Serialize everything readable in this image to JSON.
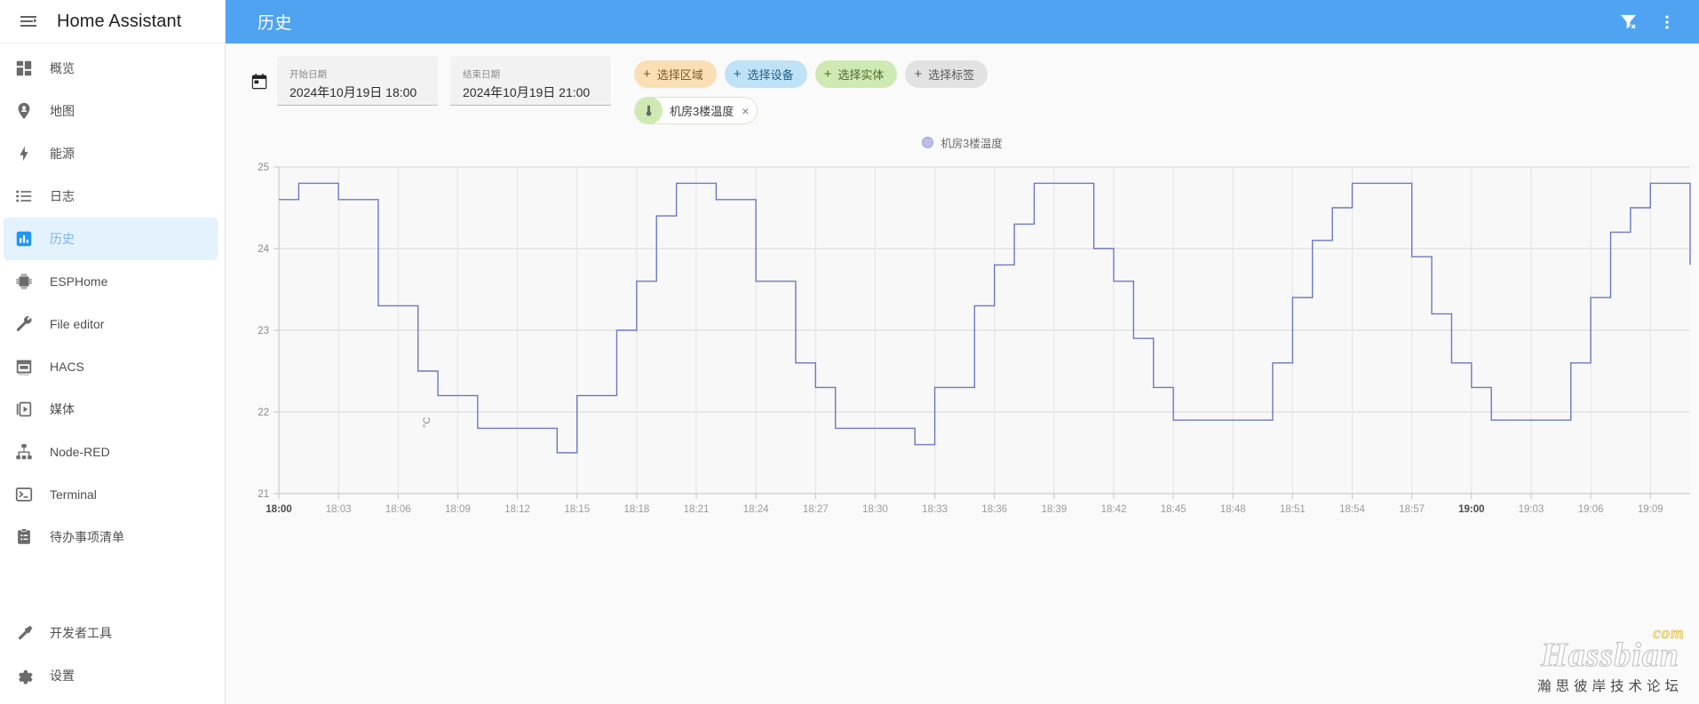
{
  "sidebar": {
    "title": "Home Assistant",
    "menu_icon": "menu-collapse-icon",
    "items": [
      {
        "label": "概览",
        "icon": "view-dashboard-icon",
        "active": false
      },
      {
        "label": "地图",
        "icon": "map-marker-account-icon",
        "active": false
      },
      {
        "label": "能源",
        "icon": "lightning-bolt-icon",
        "active": false
      },
      {
        "label": "日志",
        "icon": "format-list-bulleted-icon",
        "active": false
      },
      {
        "label": "历史",
        "icon": "chart-box-icon",
        "active": true
      },
      {
        "label": "ESPHome",
        "icon": "chip-icon",
        "active": false
      },
      {
        "label": "File editor",
        "icon": "wrench-icon",
        "active": false
      },
      {
        "label": "HACS",
        "icon": "storefront-icon",
        "active": false
      },
      {
        "label": "媒体",
        "icon": "play-box-icon",
        "active": false
      },
      {
        "label": "Node-RED",
        "icon": "sitemap-icon",
        "active": false
      },
      {
        "label": "Terminal",
        "icon": "console-icon",
        "active": false
      },
      {
        "label": "待办事项清单",
        "icon": "clipboard-list-icon",
        "active": false
      }
    ],
    "bottom_items": [
      {
        "label": "开发者工具",
        "icon": "hammer-icon"
      },
      {
        "label": "设置",
        "icon": "cog-icon"
      }
    ]
  },
  "appbar": {
    "title": "历史",
    "filter_remove_icon": "filter-remove-icon",
    "overflow_icon": "dots-vertical-icon",
    "background": "#4fa3f0"
  },
  "toolbar": {
    "calendar_icon": "calendar-icon",
    "start_date": {
      "label": "开始日期",
      "value": "2024年10月19日 18:00"
    },
    "end_date": {
      "label": "结束日期",
      "value": "2024年10月19日 21:00"
    },
    "chips": [
      {
        "label": "选择区域",
        "plus": "+",
        "color": "#fadfb5"
      },
      {
        "label": "选择设备",
        "plus": "+",
        "color": "#bfe2f7"
      },
      {
        "label": "选择实体",
        "plus": "+",
        "color": "#cfe9b2"
      },
      {
        "label": "选择标签",
        "plus": "+",
        "color": "#e2e2e2"
      }
    ],
    "entity_chip": {
      "label": "机房3楼温度",
      "icon": "thermometer-icon",
      "remove": "×"
    }
  },
  "legend": {
    "label": "机房3楼温度",
    "color": "#b9bfe8"
  },
  "watermark": {
    "brand": "Hassbian",
    "tld": "com",
    "subtitle": "瀚思彼岸技术论坛"
  },
  "chart_data": {
    "type": "line",
    "title": "",
    "xlabel": "",
    "ylabel": "°C",
    "series_name": "机房3楼温度",
    "line_color": "#6b77c4",
    "grid": true,
    "legend_position": "top-center",
    "ylim": [
      21,
      25
    ],
    "yticks": [
      21,
      22,
      23,
      24,
      25
    ],
    "xticks": [
      "18:00",
      "18:03",
      "18:06",
      "18:09",
      "18:12",
      "18:15",
      "18:18",
      "18:21",
      "18:24",
      "18:27",
      "18:30",
      "18:33",
      "18:36",
      "18:39",
      "18:42",
      "18:45",
      "18:48",
      "18:51",
      "18:54",
      "18:57",
      "19:00",
      "19:03",
      "19:06",
      "19:09"
    ],
    "xtick_bold": [
      "18:00",
      "19:00"
    ],
    "x_range": [
      "18:00",
      "19:11"
    ],
    "step_style": "step-after",
    "x": [
      "18:00",
      "18:01",
      "18:02",
      "18:03",
      "18:04",
      "18:05",
      "18:06",
      "18:07",
      "18:08",
      "18:09",
      "18:10",
      "18:11",
      "18:12",
      "18:13",
      "18:14",
      "18:15",
      "18:16",
      "18:17",
      "18:18",
      "18:19",
      "18:20",
      "18:21",
      "18:22",
      "18:23",
      "18:24",
      "18:25",
      "18:26",
      "18:27",
      "18:28",
      "18:29",
      "18:30",
      "18:31",
      "18:32",
      "18:33",
      "18:34",
      "18:35",
      "18:36",
      "18:37",
      "18:38",
      "18:39",
      "18:40",
      "18:41",
      "18:42",
      "18:43",
      "18:44",
      "18:45",
      "18:46",
      "18:47",
      "18:48",
      "18:49",
      "18:50",
      "18:51",
      "18:52",
      "18:53",
      "18:54",
      "18:55",
      "18:56",
      "18:57",
      "18:58",
      "18:59",
      "19:00",
      "19:01",
      "19:02",
      "19:03",
      "19:04",
      "19:05",
      "19:06",
      "19:07",
      "19:08",
      "19:09",
      "19:10",
      "19:11"
    ],
    "values": [
      24.6,
      24.8,
      24.8,
      24.6,
      24.6,
      23.3,
      23.3,
      22.5,
      22.2,
      22.2,
      21.8,
      21.8,
      21.8,
      21.8,
      21.5,
      22.2,
      22.2,
      23.0,
      23.6,
      24.4,
      24.8,
      24.8,
      24.6,
      24.6,
      23.6,
      23.6,
      22.6,
      22.3,
      21.8,
      21.8,
      21.8,
      21.8,
      21.6,
      22.3,
      22.3,
      23.3,
      23.8,
      24.3,
      24.8,
      24.8,
      24.8,
      24.0,
      23.6,
      22.9,
      22.3,
      21.9,
      21.9,
      21.9,
      21.9,
      21.9,
      22.6,
      23.4,
      24.1,
      24.5,
      24.8,
      24.8,
      24.8,
      23.9,
      23.2,
      22.6,
      22.3,
      21.9,
      21.9,
      21.9,
      21.9,
      22.6,
      23.4,
      24.2,
      24.5,
      24.8,
      24.8,
      23.8
    ]
  }
}
